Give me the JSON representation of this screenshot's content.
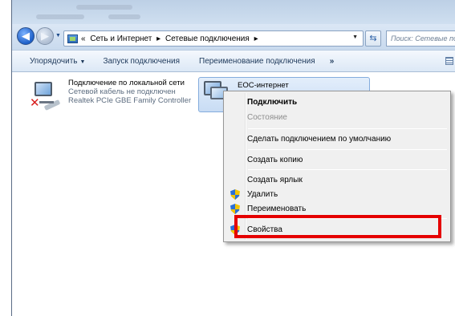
{
  "address_bar": {
    "path_prefix": "«",
    "crumb_1": "Сеть и Интернет",
    "crumb_2": "Сетевые подключения",
    "separator": "▸",
    "search_placeholder": "Поиск: Сетевые подключения"
  },
  "toolbar": {
    "organize_label": "Упорядочить",
    "organize_arrow": "▼",
    "start_connection_label": "Запуск подключения",
    "rename_connection_label": "Переименование подключения",
    "more_label": "»"
  },
  "connections": [
    {
      "name": "Подключение по локальной сети",
      "status": "Сетевой кабель не подключен",
      "device": "Realtek PCIe GBE Family Controller",
      "error_icon": "red-x-icon"
    },
    {
      "name": "ЕОС-интернет",
      "selected": true
    }
  ],
  "context_menu": {
    "items": [
      {
        "label": "Подключить",
        "bold": true
      },
      {
        "label": "Состояние",
        "disabled": true
      },
      {
        "label": "Сделать подключением по умолчанию"
      },
      {
        "label": "Создать копию"
      },
      {
        "label": "Создать ярлык"
      },
      {
        "label": "Удалить",
        "icon": "uac-shield-icon"
      },
      {
        "label": "Переименовать",
        "icon": "uac-shield-icon"
      },
      {
        "label": "Свойства",
        "icon": "uac-shield-icon",
        "highlighted": true
      }
    ]
  },
  "colors": {
    "highlight_border": "#e50000",
    "menu_background": "#f0f0f0",
    "selection_background": "#c8dcf4"
  },
  "icons": {
    "back": "back-arrow-icon",
    "forward": "forward-arrow-icon",
    "refresh": "refresh-icon",
    "view": "view-options-icon",
    "folder": "control-panel-icon"
  }
}
